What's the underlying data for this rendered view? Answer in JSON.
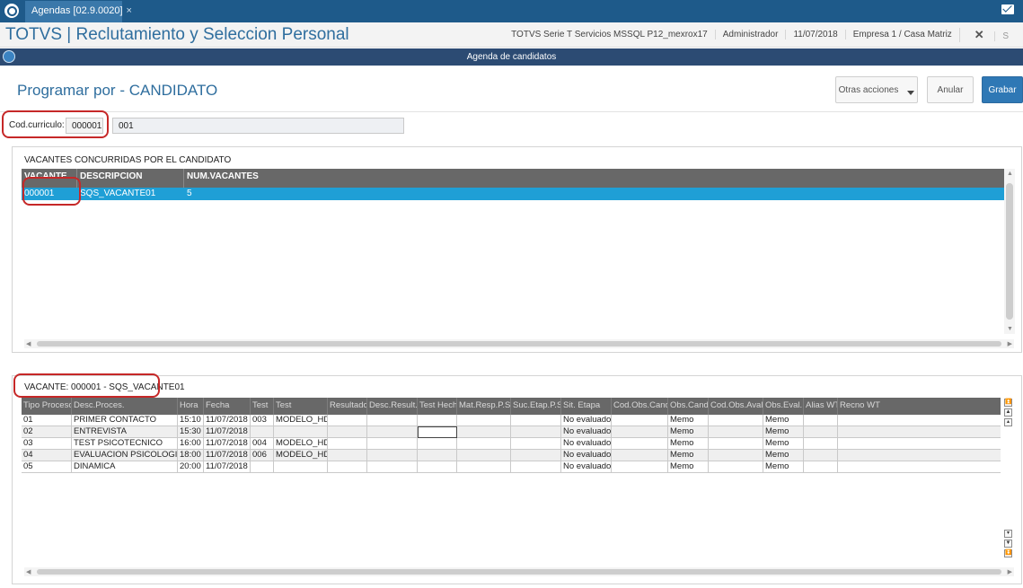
{
  "browser": {
    "tab_title": "Agendas [02.9.0020]",
    "tab_close": "×"
  },
  "header": {
    "app_title": "TOTVS | Reclutamiento y Seleccion Personal",
    "environment": "TOTVS Serie T Servicios MSSQL P12_mexrox17",
    "user": "Administrador",
    "date": "11/07/2018",
    "company": "Empresa 1 / Casa Matriz",
    "close_label": "✕",
    "trailing": "S"
  },
  "window": {
    "title": "Agenda de candidatos"
  },
  "page": {
    "title": "Programar por - CANDIDATO",
    "otras_acciones": "Otras acciones",
    "anular": "Anular",
    "grabar": "Grabar"
  },
  "curriculo": {
    "label": "Cod.curriculo:",
    "code": "000001",
    "name": "001"
  },
  "vacantes": {
    "section_title": "VACANTES CONCURRIDAS POR EL CANDIDATO",
    "columns": [
      "VACANTE",
      "DESCRIPCION",
      "NUM.VACANTES"
    ],
    "rows": [
      [
        "000001",
        "SQS_VACANTE01",
        "5"
      ]
    ]
  },
  "etapas": {
    "section_title": "VACANTE: 000001 - SQS_VACANTE01",
    "columns": [
      "Tipo Proceso",
      "Desc.Proces.",
      "Hora",
      "Fecha",
      "Test",
      "Test",
      "Resultado",
      "Desc.Result.",
      "Test Hecho",
      "Mat.Resp.P.S",
      "Suc.Etap.P.S",
      "Sit. Etapa",
      "Cod.Obs.Cand",
      "Obs.Cand.",
      "Cod.Obs.Aval",
      "Obs.Eval.",
      "Alias WT",
      "Recno WT"
    ],
    "rows": [
      [
        "01",
        "PRIMER CONTACTO",
        "15:10",
        "11/07/2018",
        "003",
        "MODELO_HD",
        "",
        "",
        "",
        "",
        "",
        "No evaluado",
        "",
        "Memo",
        "",
        "Memo",
        "",
        ""
      ],
      [
        "02",
        "ENTREVISTA",
        "15:30",
        "11/07/2018",
        "",
        "",
        "",
        "",
        "",
        "",
        "",
        "No evaluado",
        "",
        "Memo",
        "",
        "Memo",
        "",
        ""
      ],
      [
        "03",
        "TEST PSICOTECNICO",
        "16:00",
        "11/07/2018",
        "004",
        "MODELO_HD",
        "",
        "",
        "",
        "",
        "",
        "No evaluado",
        "",
        "Memo",
        "",
        "Memo",
        "",
        ""
      ],
      [
        "04",
        "EVALUACION PSICOLOGICA",
        "18:00",
        "11/07/2018",
        "006",
        "MODELO_HD",
        "",
        "",
        "",
        "",
        "",
        "No evaluado",
        "",
        "Memo",
        "",
        "Memo",
        "",
        ""
      ],
      [
        "05",
        "DINAMICA",
        "20:00",
        "11/07/2018",
        "",
        "",
        "",
        "",
        "",
        "",
        "",
        "No evaluado",
        "",
        "Memo",
        "",
        "Memo",
        "",
        ""
      ]
    ]
  }
}
